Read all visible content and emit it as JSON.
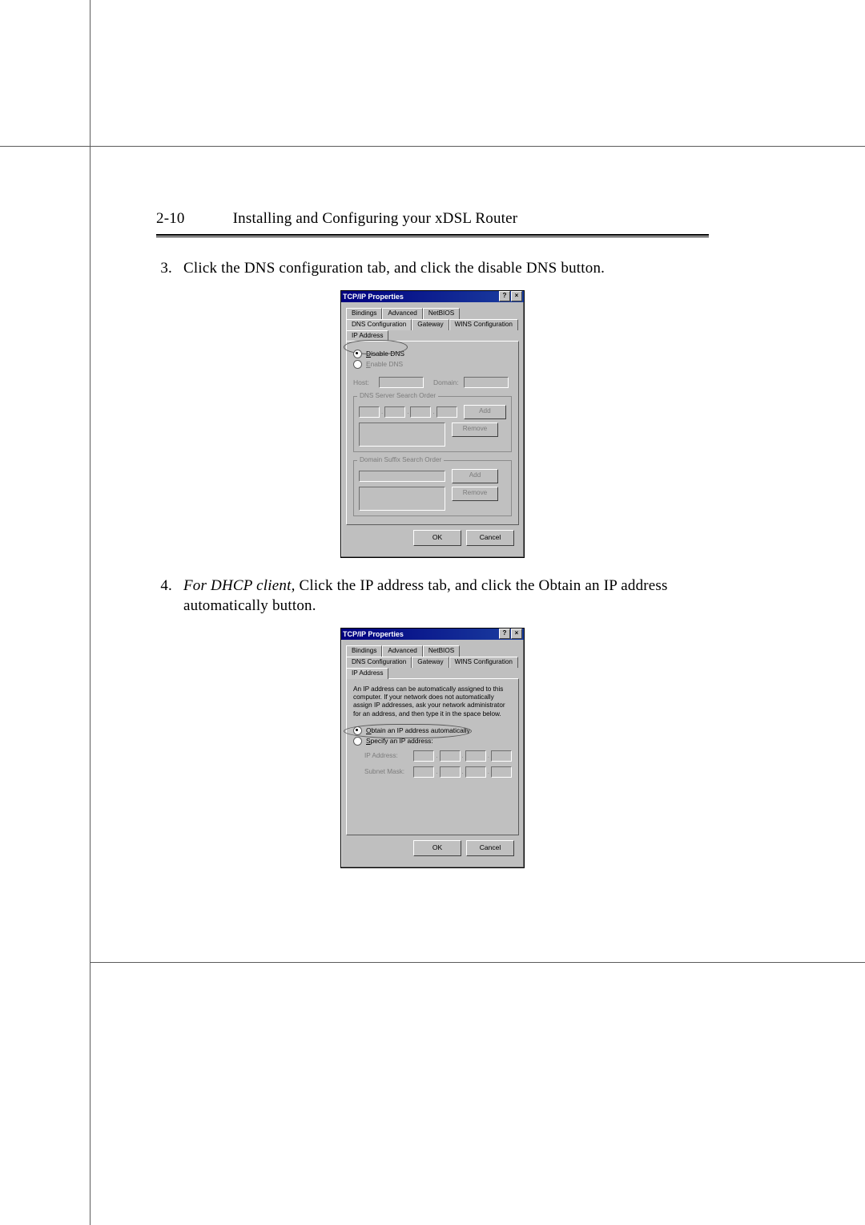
{
  "page": {
    "number": "2-10",
    "header": "Installing and Configuring your xDSL Router"
  },
  "steps": {
    "s3": {
      "num": "3.",
      "text": "Click the DNS configuration tab, and click the disable DNS button."
    },
    "s4": {
      "num": "4.",
      "lead": "For DHCP client,",
      "rest": " Click the IP address tab, and click the Obtain an IP address automatically button."
    }
  },
  "dlg": {
    "title": "TCP/IP Properties",
    "helpGlyph": "?",
    "closeGlyph": "×",
    "ok": "OK",
    "cancel": "Cancel",
    "tabs": {
      "bindings": "Bindings",
      "advanced": "Advanced",
      "netbios": "NetBIOS",
      "dnsconf": "DNS Configuration",
      "gateway": "Gateway",
      "winsconf": "WINS Configuration",
      "ipaddr": "IP Address"
    }
  },
  "dns": {
    "disable": "Disable DNS",
    "enable": "Enable DNS",
    "host": "Host:",
    "domain": "Domain:",
    "group1": "DNS Server Search Order",
    "group2": "Domain Suffix Search Order",
    "add": "Add",
    "remove": "Remove"
  },
  "ip": {
    "help": "An IP address can be automatically assigned to this computer. If your network does not automatically assign IP addresses, ask your network administrator for an address, and then type it in the space below.",
    "obtain": "Obtain an IP address automatically",
    "specify": "Specify an IP address:",
    "ipaddr": "IP Address:",
    "subnet": "Subnet Mask:"
  }
}
